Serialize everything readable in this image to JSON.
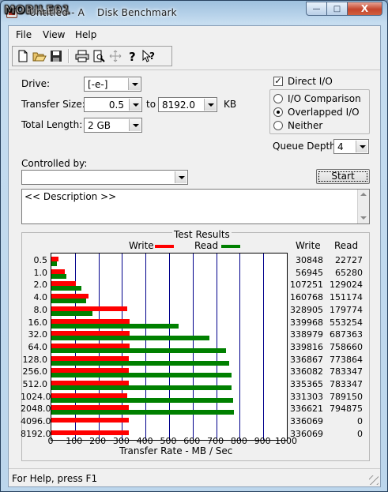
{
  "window": {
    "title": "Untitled - A",
    "title_rest": "Disk Benchmark",
    "watermark": "MOBILE01",
    "buttons": {
      "minimize": "—",
      "maximize": "□",
      "close": "X"
    }
  },
  "menu": [
    "File",
    "View",
    "Help"
  ],
  "toolbar_icons": [
    "new-icon",
    "open-icon",
    "save-icon",
    "print-icon",
    "print-preview-icon",
    "move-icon",
    "help-icon",
    "context-help-icon"
  ],
  "settings": {
    "drive_label": "Drive:",
    "drive_value": "[-e-]",
    "transfer_size_label": "Transfer Size:",
    "transfer_from": "0.5",
    "to_label": "to",
    "transfer_to": "8192.0",
    "kb_label": "KB",
    "total_length_label": "Total Length:",
    "total_length_value": "2 GB",
    "direct_io_label": "Direct I/O",
    "direct_io_checked": true,
    "io_options": [
      "I/O Comparison",
      "Overlapped I/O",
      "Neither"
    ],
    "io_selected": "Overlapped I/O",
    "queue_depth_label": "Queue Depth:",
    "queue_depth_value": "4",
    "controlled_by_label": "Controlled by:",
    "controlled_by_value": "",
    "start_label": "Start"
  },
  "description": "<< Description >>",
  "results": {
    "title": "Test Results",
    "write_label": "Write",
    "read_label": "Read",
    "write_header": "Write",
    "read_header": "Read",
    "xlabel": "Transfer Rate - MB / Sec",
    "colors": {
      "write": "#ff0000",
      "read": "#008000",
      "grid": "#00008b"
    }
  },
  "chart_data": {
    "type": "bar",
    "orientation": "horizontal",
    "title": "Test Results",
    "xlabel": "Transfer Rate - MB / Sec",
    "xlim": [
      0,
      1000
    ],
    "xticks": [
      0,
      100,
      200,
      300,
      400,
      500,
      600,
      700,
      800,
      900,
      1000
    ],
    "categories": [
      "0.5",
      "1.0",
      "2.0",
      "4.0",
      "8.0",
      "16.0",
      "32.0",
      "64.0",
      "128.0",
      "256.0",
      "512.0",
      "1024.0",
      "2048.0",
      "4096.0",
      "8192.0"
    ],
    "series": [
      {
        "name": "Write",
        "color": "#ff0000",
        "values": [
          30848,
          56945,
          107251,
          160768,
          328905,
          339968,
          338979,
          339816,
          336867,
          336082,
          335365,
          331303,
          336621,
          336069,
          336069
        ]
      },
      {
        "name": "Read",
        "color": "#008000",
        "values": [
          22727,
          65280,
          129024,
          151174,
          179774,
          553254,
          687363,
          758660,
          773864,
          783347,
          783347,
          789150,
          794875,
          0,
          0
        ]
      }
    ],
    "value_unit": "KB/s"
  },
  "status": "For Help, press F1"
}
